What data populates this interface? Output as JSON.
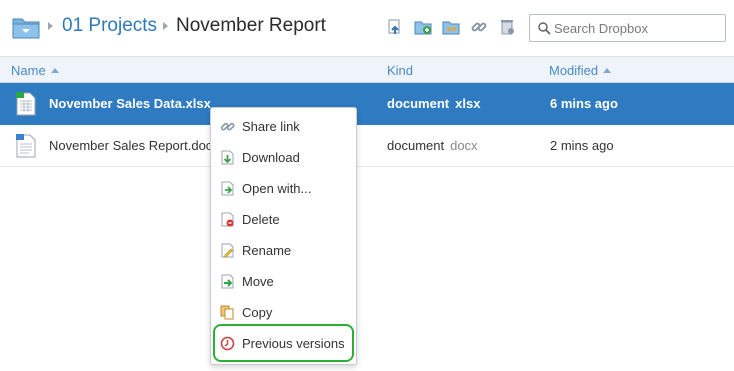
{
  "breadcrumb": {
    "root_icon": "folder-icon",
    "parent": "01 Projects",
    "current": "November Report"
  },
  "toolbar": {
    "icons": [
      "upload-icon",
      "new-folder-icon",
      "share-folder-icon",
      "share-link-icon",
      "deleted-files-icon"
    ]
  },
  "search": {
    "placeholder": "Search Dropbox",
    "value": ""
  },
  "columns": {
    "name": "Name",
    "kind": "Kind",
    "modified": "Modified"
  },
  "files": [
    {
      "name": "November Sales Data.xlsx",
      "kind": "document",
      "ext": "xlsx",
      "modified": "6 mins ago",
      "selected": true,
      "icon": "spreadsheet-icon"
    },
    {
      "name": "November Sales Report.docx",
      "kind": "document",
      "ext": "docx",
      "modified": "2 mins ago",
      "selected": false,
      "icon": "document-icon"
    }
  ],
  "context_menu": {
    "items": [
      {
        "label": "Share link",
        "icon": "link-icon"
      },
      {
        "label": "Download",
        "icon": "download-icon"
      },
      {
        "label": "Open with...",
        "icon": "open-with-icon"
      },
      {
        "label": "Delete",
        "icon": "delete-icon"
      },
      {
        "label": "Rename",
        "icon": "rename-icon"
      },
      {
        "label": "Move",
        "icon": "move-icon"
      },
      {
        "label": "Copy",
        "icon": "copy-icon"
      },
      {
        "label": "Previous versions",
        "icon": "clock-icon"
      }
    ],
    "highlighted": "Previous versions"
  },
  "colors": {
    "selection": "#2f7bc1",
    "link": "#2e7ab8",
    "highlight_border": "#2fae36"
  }
}
